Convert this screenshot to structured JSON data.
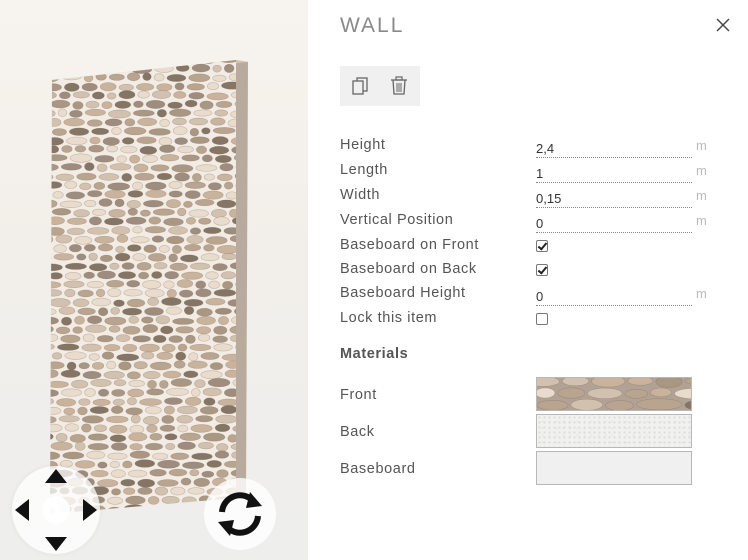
{
  "viewport": {
    "icons": [
      "pan-arrows-icon",
      "rotate-icon"
    ]
  },
  "panel": {
    "title": "WALL",
    "actions": [
      "copy-icon",
      "trash-icon"
    ],
    "properties": {
      "height": {
        "label": "Height",
        "value": "2,4",
        "unit": "m"
      },
      "length": {
        "label": "Length",
        "value": "1",
        "unit": "m"
      },
      "width": {
        "label": "Width",
        "value": "0,15",
        "unit": "m"
      },
      "vertical_position": {
        "label": "Vertical Position",
        "value": "0",
        "unit": "m"
      },
      "baseboard_front": {
        "label": "Baseboard on Front",
        "checked": true
      },
      "baseboard_back": {
        "label": "Baseboard on Back",
        "checked": true
      },
      "baseboard_height": {
        "label": "Baseboard Height",
        "value": "0",
        "unit": "m"
      },
      "lock_item": {
        "label": "Lock this item",
        "checked": false
      }
    },
    "materials": {
      "heading": "Materials",
      "front": {
        "label": "Front",
        "swatch": "stone"
      },
      "back": {
        "label": "Back",
        "swatch": "white-plaster"
      },
      "baseboard": {
        "label": "Baseboard",
        "swatch": "plain-light-gray"
      }
    }
  },
  "colors": {
    "stone_light": "#e9dccd",
    "stone_mid": "#b9a48f",
    "stone_dark": "#857565",
    "mortar": "#f4eee7",
    "text": "#555555",
    "unit": "#bbbbbb"
  }
}
